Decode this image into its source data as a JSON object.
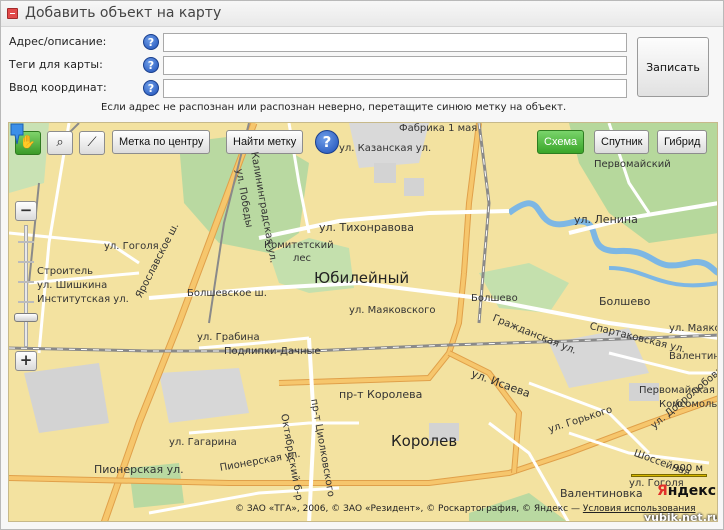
{
  "window": {
    "title": "Добавить объект на карту"
  },
  "form": {
    "address_label": "Адрес/описание:",
    "tags_label": "Теги для карты:",
    "coords_label": "Ввод координат:",
    "address_value": "",
    "tags_value": "",
    "coords_value": "",
    "help_glyph": "?",
    "save_label": "Записать",
    "hint": "Если адрес не распознан или распознан неверно, перетащите синюю метку на объект."
  },
  "toolbar": {
    "hand_icon": "hand-icon",
    "zoom_rect_icon": "magnifier-icon",
    "ruler_icon": "ruler-icon",
    "center_mark_label": "Метка по центру",
    "find_mark_label": "Найти метку",
    "help_glyph": "?",
    "map_types": [
      "Схема",
      "Спутник",
      "Гибрид"
    ],
    "active_map_type": "Схема"
  },
  "zoom": {
    "plus": "+",
    "minus": "−",
    "level": 0.08
  },
  "map": {
    "places": {
      "yubileyny": "Юбилейный",
      "korolev": "Королев",
      "bolshevo": "Болшево",
      "pervomaysky": "Первомайский",
      "valentinovka": "Валентиновка"
    },
    "streets": {
      "fabrika": "Фабрика 1 мая",
      "kazanskaya": "ул. Казанская ул.",
      "kaliningradskaya": "Калининградская ул.",
      "pobedy": "ул. Победы",
      "tikhonravova": "ул. Тихонравова",
      "lenina": "ул. Ленина",
      "komitetsky_1": "Комитетский",
      "komitetsky_2": "лес",
      "yaroslavskoe": "Ярославское ш.",
      "gogolya_top": "ул. Гоголя",
      "stroitel": "Строитель",
      "shishkina": "ул. Шишкина",
      "institutskaya": "Институтская ул.",
      "bolshevskoe": "Болшевское ш.",
      "mayakovskogo": "ул. Маяковского",
      "bolshevo_station": "Болшево",
      "grazhdanskaya": "Гражданская ул.",
      "spartakovskaya": "Спартаковская ул.",
      "gribana": "ул. Грабина",
      "podlipki": "Подлипки-Дачные",
      "isaeva": "ул. Исаева",
      "koroleva": "пр-т Королева",
      "tsiolkovskogo": "пр-т Циолковского",
      "oktyabrsky": "Октябрьский б-р",
      "gagarina": "ул. Гагарина",
      "gorkogo": "ул. Горького",
      "dobrolyubova": "ул. Добролюбова",
      "pionerskaya": "Пионерская ул.",
      "shosseynaya": "Шоссейная",
      "mayakovskogo_right": "ул. Маяковского",
      "gogolya_right": "ул. Гоголя",
      "valentinovka_st": "Валентиновка",
      "pervomayskaya": "Первомайская",
      "komsomolskaya": "Комсомольская"
    },
    "scale": "900 м",
    "logo_ya": "Я",
    "logo_rest": "ндекс",
    "copyright": "© ЗАО «ТГА», 2006, © ЗАО «Резидент», © Роскартография, © Яндекс — ",
    "terms_link": "Условия использования",
    "watermark": "yubik.net.ru"
  }
}
